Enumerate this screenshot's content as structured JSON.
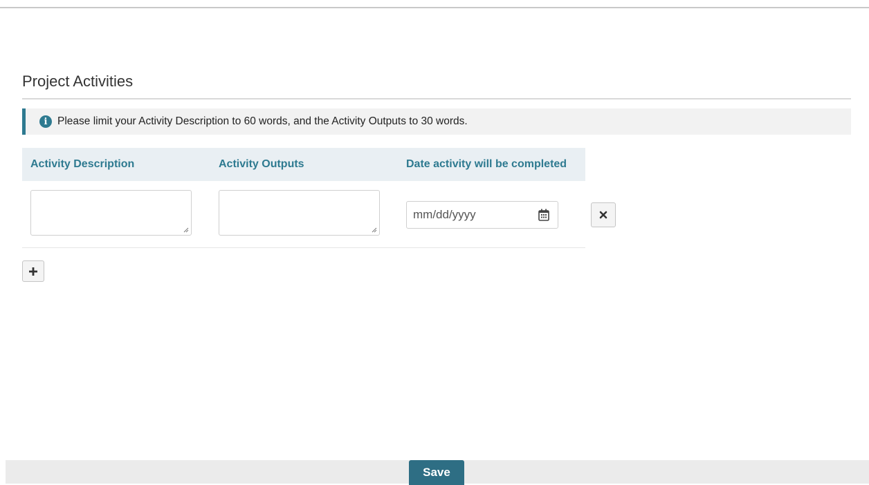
{
  "section": {
    "title": "Project Activities",
    "info_message": "Please limit your Activity Description to 60 words, and the Activity Outputs to 30 words.",
    "info_icon": "info-icon"
  },
  "table": {
    "headers": {
      "description": "Activity Description",
      "outputs": "Activity Outputs",
      "date": "Date activity will be completed"
    },
    "rows": [
      {
        "description": "",
        "outputs": "",
        "date_placeholder": "mm/dd/yyyy"
      }
    ]
  },
  "buttons": {
    "remove_icon": "close-icon",
    "add_icon": "plus-icon",
    "save_label": "Save"
  },
  "colors": {
    "accent": "#2e7a90",
    "save_button": "#2e6e84",
    "header_bg": "#e9eff3",
    "info_bg": "#f2f2f2",
    "footer_bg": "#ebebeb"
  }
}
